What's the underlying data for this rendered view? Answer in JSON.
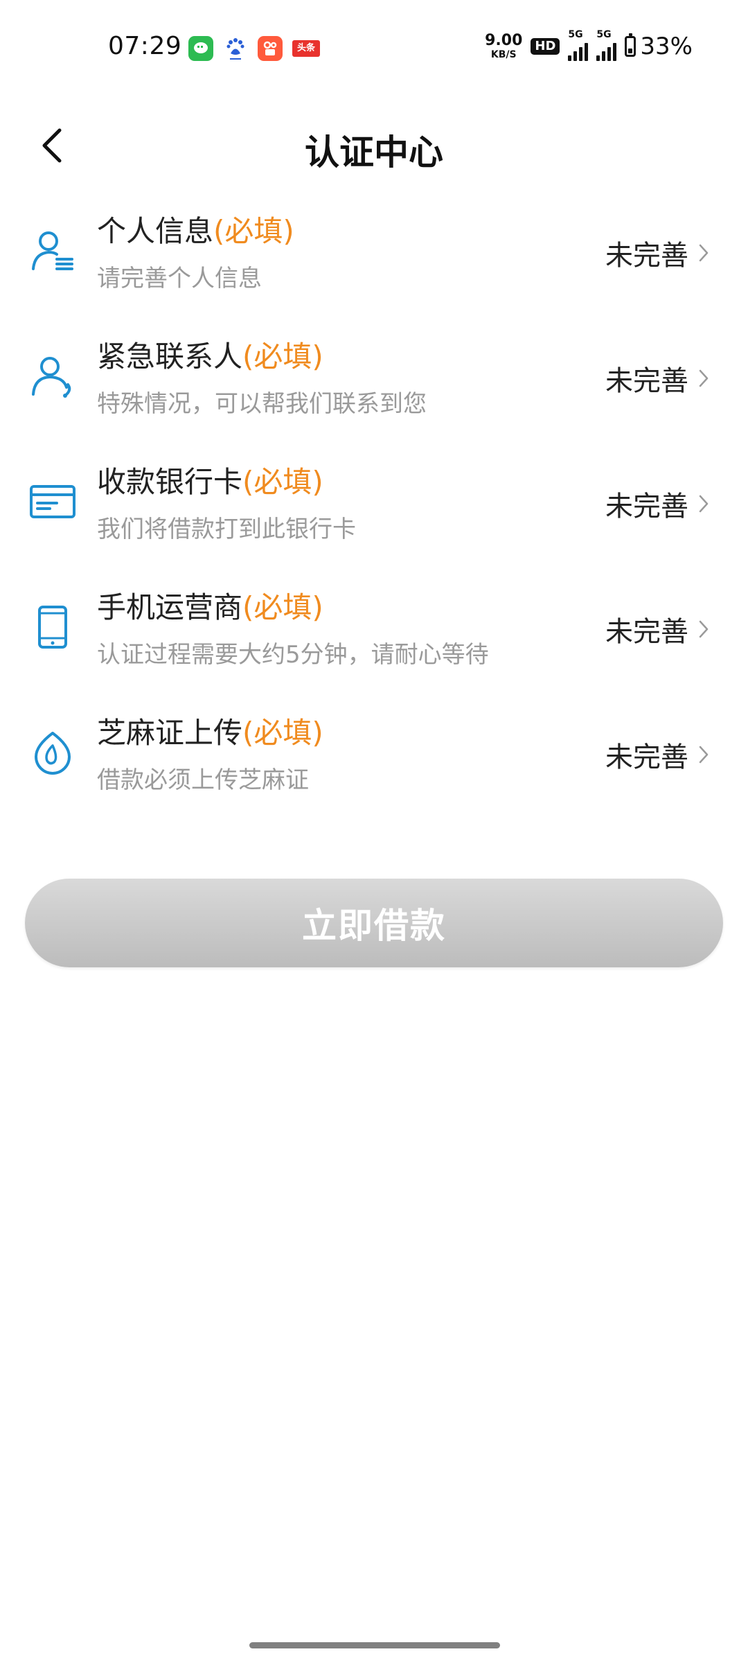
{
  "status_bar": {
    "time": "07:29",
    "notification_icons": [
      "wechat-icon",
      "baidu-icon",
      "kuaishou-icon",
      "toutiao-icon"
    ],
    "toutiao_label": "头条",
    "net_speed_value": "9.00",
    "net_speed_unit": "KB/S",
    "hd_label": "HD",
    "sim1_label": "5G",
    "sim2_label": "5G",
    "battery_percent": "33%",
    "battery_level": 0.33
  },
  "header": {
    "title": "认证中心",
    "back_icon": "chevron-left-icon"
  },
  "items": [
    {
      "title": "个人信息",
      "required": "(必填)",
      "subtitle": "请完善个人信息",
      "status": "未完善",
      "icon": "person-list-icon"
    },
    {
      "title": "紧急联系人",
      "required": "(必填)",
      "subtitle": "特殊情况，可以帮我们联系到您",
      "status": "未完善",
      "icon": "person-phone-icon"
    },
    {
      "title": "收款银行卡",
      "required": "(必填)",
      "subtitle": "我们将借款打到此银行卡",
      "status": "未完善",
      "icon": "bank-card-icon"
    },
    {
      "title": "手机运营商",
      "required": "(必填)",
      "subtitle": "认证过程需要大约5分钟，请耐心等待",
      "status": "未完善",
      "icon": "mobile-phone-icon"
    },
    {
      "title": "芝麻证上传",
      "required": "(必填)",
      "subtitle": "借款必须上传芝麻证",
      "status": "未完善",
      "icon": "sesame-drop-icon"
    }
  ],
  "loan_button": {
    "label": "立即借款",
    "enabled": false
  },
  "colors": {
    "accent_blue": "#1f8fd0",
    "required_orange": "#f08b1f",
    "subtitle_gray": "#9a9a9a",
    "button_gray": "#c8c8c8"
  }
}
